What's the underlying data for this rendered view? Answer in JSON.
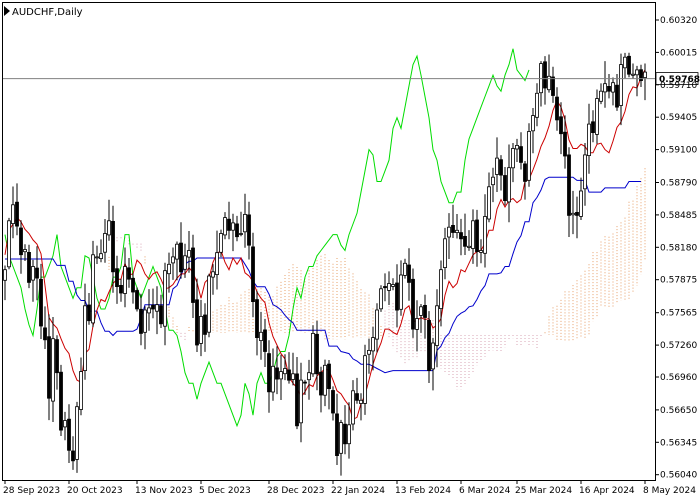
{
  "chart_data": {
    "type": "candlestick",
    "title": "AUDCHF,Daily",
    "ylim": [
      0.5599,
      0.6048
    ],
    "y_ticks": [
      0.6032,
      0.60015,
      0.5971,
      0.59405,
      0.591,
      0.5879,
      0.58485,
      0.5818,
      0.57875,
      0.57565,
      0.5726,
      0.5696,
      0.5665,
      0.56345,
      0.5604
    ],
    "y_tick_labels": [
      "0.60320",
      "0.60015",
      "0.59710",
      "0.59405",
      "0.59100",
      "0.58790",
      "0.58485",
      "0.58180",
      "0.57875",
      "0.57565",
      "0.57260",
      "0.56960",
      "0.56650",
      "0.56345",
      "0.56040"
    ],
    "x_labels": [
      "28 Sep 2023",
      "20 Oct 2023",
      "13 Nov 2023",
      "5 Dec 2023",
      "28 Dec 2023",
      "22 Jan 2024",
      "13 Feb 2024",
      "6 Mar 2024",
      "25 Mar 2024",
      "16 Apr 2024",
      "8 May 2024"
    ],
    "x_label_index": [
      0,
      16,
      33,
      49,
      66,
      82,
      98,
      114,
      128,
      144,
      160
    ],
    "current_price": 0.59768,
    "current_price_label": "0.59768",
    "grid": false,
    "colors": {
      "tenkan": "#cc0000",
      "kijun": "#0000cc",
      "chikou": "#00dd00",
      "cloud_bull": "#e6a06a",
      "cloud_bear": "#d8a6b4",
      "candle": "#000000",
      "price_line": "#808080"
    },
    "close": [
      0.5797,
      0.5843,
      0.5858,
      0.5838,
      0.5811,
      0.5816,
      0.5785,
      0.58,
      0.5789,
      0.5744,
      0.5731,
      0.5676,
      0.5732,
      0.57,
      0.5646,
      0.5655,
      0.5627,
      0.5617,
      0.5668,
      0.5701,
      0.5763,
      0.5749,
      0.5811,
      0.5809,
      0.5812,
      0.5831,
      0.5843,
      0.5795,
      0.5781,
      0.5775,
      0.58,
      0.5788,
      0.5776,
      0.576,
      0.5737,
      0.5759,
      0.5761,
      0.576,
      0.5764,
      0.5746,
      0.5796,
      0.5802,
      0.5809,
      0.5821,
      0.5795,
      0.581,
      0.5815,
      0.5766,
      0.5726,
      0.5753,
      0.5736,
      0.5791,
      0.5795,
      0.5813,
      0.5831,
      0.5846,
      0.5834,
      0.5841,
      0.5828,
      0.5831,
      0.5849,
      0.582,
      0.5767,
      0.5733,
      0.5738,
      0.572,
      0.5682,
      0.5706,
      0.5694,
      0.5701,
      0.5704,
      0.5693,
      0.5699,
      0.565,
      0.5693,
      0.5691,
      0.57,
      0.5737,
      0.5699,
      0.5679,
      0.5707,
      0.5685,
      0.5662,
      0.5622,
      0.5653,
      0.5633,
      0.5651,
      0.5683,
      0.5674,
      0.5674,
      0.5716,
      0.5721,
      0.5733,
      0.5759,
      0.5779,
      0.578,
      0.5784,
      0.5783,
      0.5759,
      0.5792,
      0.5803,
      0.5785,
      0.5741,
      0.5751,
      0.5762,
      0.5752,
      0.5702,
      0.5728,
      0.5763,
      0.5797,
      0.5826,
      0.5837,
      0.5832,
      0.5834,
      0.5826,
      0.5819,
      0.5819,
      0.5843,
      0.5814,
      0.5815,
      0.5847,
      0.5875,
      0.5884,
      0.5902,
      0.5886,
      0.5862,
      0.5893,
      0.5911,
      0.5914,
      0.5898,
      0.588,
      0.5927,
      0.5942,
      0.5963,
      0.5991,
      0.5968,
      0.5979,
      0.5961,
      0.5938,
      0.5925,
      0.5904,
      0.5848,
      0.585,
      0.5848,
      0.5871,
      0.5905,
      0.5934,
      0.5926,
      0.5958,
      0.5965,
      0.5972,
      0.5965,
      0.5973,
      0.595,
      0.599,
      0.5997,
      0.5981,
      0.5981,
      0.5985,
      0.5975,
      0.5983
    ],
    "tenkan": [
      0.5811,
      0.5834,
      0.584,
      0.5846,
      0.5842,
      0.5835,
      0.5831,
      0.5825,
      0.5821,
      0.5812,
      0.5782,
      0.5752,
      0.5746,
      0.5742,
      0.5732,
      0.5723,
      0.5718,
      0.5702,
      0.5693,
      0.5691,
      0.5718,
      0.5722,
      0.5744,
      0.5759,
      0.5769,
      0.5767,
      0.5776,
      0.5784,
      0.5788,
      0.5788,
      0.5803,
      0.5792,
      0.5793,
      0.5806,
      0.5802,
      0.5793,
      0.5788,
      0.5793,
      0.5795,
      0.5788,
      0.5779,
      0.578,
      0.5783,
      0.5789,
      0.5793,
      0.5793,
      0.5799,
      0.5794,
      0.5785,
      0.577,
      0.5785,
      0.5789,
      0.5804,
      0.5812,
      0.5815,
      0.5804,
      0.5797,
      0.5808,
      0.5802,
      0.5808,
      0.5794,
      0.5791,
      0.5786,
      0.5776,
      0.577,
      0.5766,
      0.5747,
      0.5734,
      0.5726,
      0.5718,
      0.5713,
      0.5696,
      0.569,
      0.5686,
      0.5677,
      0.5682,
      0.5689,
      0.5687,
      0.5697,
      0.57,
      0.5704,
      0.5702,
      0.5693,
      0.5683,
      0.568,
      0.5674,
      0.5669,
      0.5656,
      0.5658,
      0.5671,
      0.5679,
      0.5693,
      0.5708,
      0.5719,
      0.5728,
      0.5741,
      0.5741,
      0.5738,
      0.5736,
      0.5746,
      0.576,
      0.5763,
      0.5748,
      0.5749,
      0.5752,
      0.575,
      0.5751,
      0.5742,
      0.5745,
      0.5751,
      0.5773,
      0.5786,
      0.578,
      0.5784,
      0.5797,
      0.5795,
      0.5803,
      0.5811,
      0.5814,
      0.5815,
      0.5822,
      0.5834,
      0.5834,
      0.5854,
      0.5863,
      0.5856,
      0.5862,
      0.5864,
      0.586,
      0.5863,
      0.588,
      0.5882,
      0.5891,
      0.5901,
      0.5913,
      0.5921,
      0.5932,
      0.5947,
      0.5956,
      0.595,
      0.5938,
      0.5919,
      0.5911,
      0.5911,
      0.5915,
      0.5913,
      0.5907,
      0.5907,
      0.5915,
      0.5916,
      0.591,
      0.5907,
      0.5918,
      0.5931,
      0.5936,
      0.5946,
      0.5962,
      0.5969,
      0.5968,
      0.5978,
      0.5985
    ],
    "kijun": [
      0.5807,
      0.5807,
      0.5807,
      0.5807,
      0.5807,
      0.5807,
      0.5807,
      0.5807,
      0.5807,
      0.5807,
      0.5807,
      0.5807,
      0.5807,
      0.5801,
      0.5801,
      0.5801,
      0.5786,
      0.5786,
      0.5773,
      0.5768,
      0.5768,
      0.5758,
      0.5758,
      0.5758,
      0.5747,
      0.5739,
      0.5739,
      0.5735,
      0.5739,
      0.5739,
      0.5739,
      0.5739,
      0.5739,
      0.5741,
      0.5751,
      0.5764,
      0.5764,
      0.5764,
      0.5764,
      0.5764,
      0.5764,
      0.5764,
      0.5779,
      0.5782,
      0.5791,
      0.5802,
      0.5805,
      0.5805,
      0.5808,
      0.5808,
      0.5808,
      0.5808,
      0.5808,
      0.5808,
      0.5808,
      0.5808,
      0.5808,
      0.5808,
      0.5808,
      0.5808,
      0.5802,
      0.5796,
      0.5786,
      0.5781,
      0.5781,
      0.5781,
      0.5774,
      0.5764,
      0.5762,
      0.5759,
      0.5754,
      0.575,
      0.5747,
      0.574,
      0.574,
      0.574,
      0.574,
      0.574,
      0.574,
      0.574,
      0.574,
      0.5725,
      0.5725,
      0.5725,
      0.572,
      0.5719,
      0.5718,
      0.5713,
      0.5711,
      0.5708,
      0.5708,
      0.5708,
      0.5706,
      0.5704,
      0.5702,
      0.57,
      0.5701,
      0.5702,
      0.5702,
      0.5702,
      0.5702,
      0.5702,
      0.5702,
      0.5702,
      0.5702,
      0.5702,
      0.5702,
      0.5702,
      0.5721,
      0.5725,
      0.5733,
      0.5737,
      0.5746,
      0.5753,
      0.5756,
      0.5758,
      0.5762,
      0.5763,
      0.5769,
      0.5777,
      0.5782,
      0.5793,
      0.5793,
      0.5793,
      0.5794,
      0.58,
      0.58,
      0.5812,
      0.5823,
      0.5829,
      0.5842,
      0.5842,
      0.586,
      0.5865,
      0.5872,
      0.5882,
      0.5884,
      0.5884,
      0.5884,
      0.5884,
      0.5884,
      0.5884,
      0.5884,
      0.5881,
      0.5881,
      0.5881,
      0.587,
      0.587,
      0.587,
      0.587,
      0.5874,
      0.5874,
      0.5874,
      0.5874,
      0.5874,
      0.5874,
      0.588,
      0.588,
      0.588,
      0.588
    ],
    "chikou": [
      0.583,
      0.581,
      0.58,
      0.579,
      0.578,
      0.576,
      0.5745,
      0.5735,
      0.576,
      0.579,
      0.579,
      0.58,
      0.581,
      0.583,
      0.58,
      0.579,
      0.578,
      0.577,
      0.578,
      0.578,
      0.581,
      0.5808,
      0.579,
      0.577,
      0.576,
      0.576,
      0.577,
      0.579,
      0.579,
      0.58,
      0.583,
      0.583,
      0.579,
      0.578,
      0.577,
      0.578,
      0.579,
      0.58,
      0.579,
      0.578,
      0.576,
      0.574,
      0.574,
      0.5735,
      0.572,
      0.57,
      0.569,
      0.569,
      0.5675,
      0.569,
      0.57,
      0.571,
      0.57,
      0.569,
      0.569,
      0.568,
      0.567,
      0.566,
      0.565,
      0.566,
      0.569,
      0.568,
      0.566,
      0.569,
      0.57,
      0.569,
      0.569,
      0.57,
      0.5715,
      0.572,
      0.572,
      0.5735,
      0.576,
      0.578,
      0.577,
      0.579,
      0.58,
      0.58,
      0.581,
      0.5815,
      0.582,
      0.5825,
      0.583,
      0.583,
      0.582,
      0.5815,
      0.583,
      0.584,
      0.585,
      0.587,
      0.589,
      0.591,
      0.5905,
      0.588,
      0.588,
      0.589,
      0.59,
      0.593,
      0.594,
      0.593,
      0.595,
      0.597,
      0.599,
      0.5998,
      0.598,
      0.596,
      0.594,
      0.591,
      0.59,
      0.588,
      0.587,
      0.586,
      0.586,
      0.587,
      0.587,
      0.59,
      0.592,
      0.593,
      0.594,
      0.595,
      0.596,
      0.597,
      0.598,
      0.597,
      0.5965,
      0.598,
      0.599,
      0.6005,
      0.5985,
      0.598,
      0.5975,
      0.5985
    ]
  }
}
